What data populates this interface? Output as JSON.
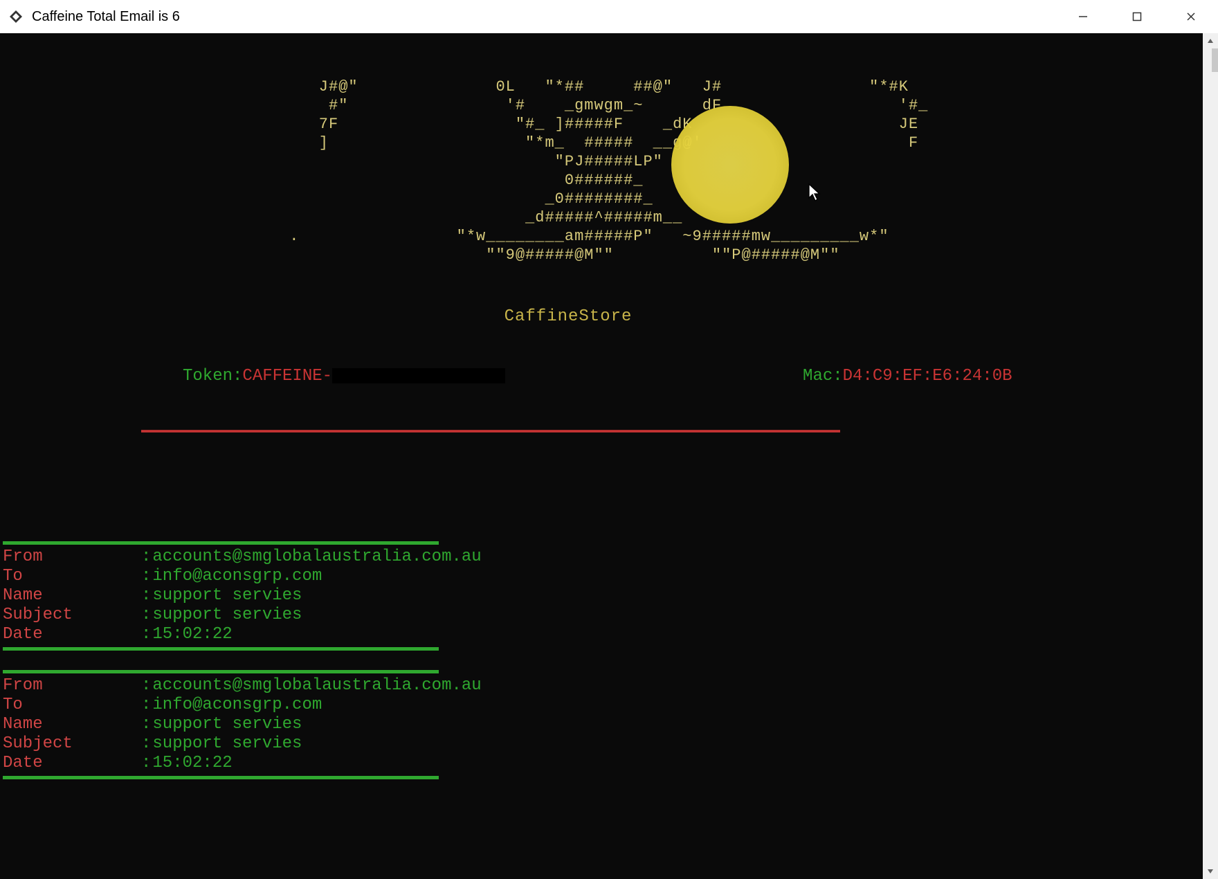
{
  "window": {
    "title": "Caffeine  Total Email is  6"
  },
  "ascii_art": "    J#@\"              0L   \"*##     ##@\"   J#               \"*#K\n     #\"                '#    _gmwgm_~      dF                  '#_\n    7F                  \"#_ ]#####F    _dK                     JE\n    ]                    \"*m_  #####  __g@'                     F\n                            \"PJ#####LP\"\n                             0######_\n                           _0########_\n                         _d#####^#####m__\n .                \"*w________am#####P\"   ~9#####mw_________w*\"\n                     \"\"9@#####@M\"\"          \"\"P@#####@M\"\"",
  "store_name": "CaffineStore",
  "token": {
    "label": "Token:",
    "value_prefix": "CAFFEINE-",
    "mac_label": "Mac:",
    "mac_value": "D4:C9:EF:E6:24:0B"
  },
  "records": [
    {
      "From": "accounts@smglobalaustralia.com.au",
      "To": "info@aconsgrp.com",
      "Name": "support servies",
      "Subject": "support servies",
      "Date": "15:02:22"
    },
    {
      "From": "accounts@smglobalaustralia.com.au",
      "To": "info@aconsgrp.com",
      "Name": "support servies",
      "Subject": "support servies",
      "Date": "15:02:22"
    }
  ],
  "field_order": [
    "From",
    "To",
    "Name",
    "Subject",
    "Date"
  ]
}
